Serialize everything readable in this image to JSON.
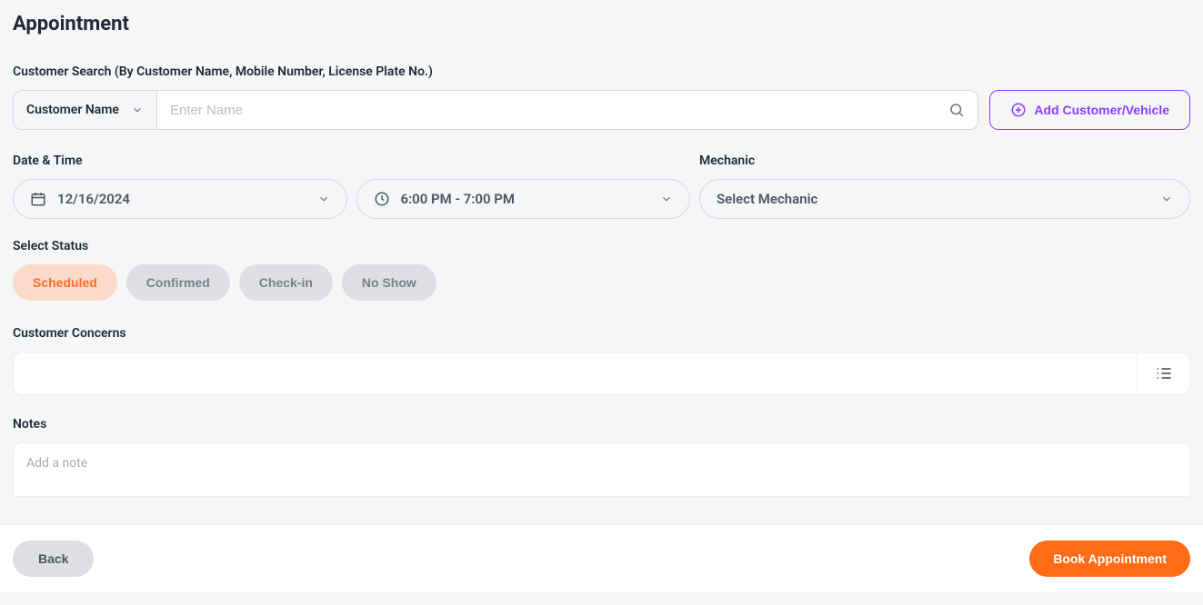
{
  "page_title": "Appointment",
  "customer_search": {
    "label": "Customer Search (By Customer Name, Mobile Number, License Plate No.)",
    "search_type": "Customer Name",
    "placeholder": "Enter Name",
    "value": ""
  },
  "add_customer_button": "Add Customer/Vehicle",
  "datetime": {
    "label": "Date & Time",
    "date": "12/16/2024",
    "time": "6:00 PM - 7:00 PM"
  },
  "mechanic": {
    "label": "Mechanic",
    "placeholder": "Select Mechanic",
    "value": ""
  },
  "status": {
    "label": "Select Status",
    "options": [
      "Scheduled",
      "Confirmed",
      "Check-in",
      "No Show"
    ],
    "selected": "Scheduled"
  },
  "concerns": {
    "label": "Customer Concerns"
  },
  "notes": {
    "label": "Notes",
    "placeholder": "Add a note",
    "value": ""
  },
  "footer": {
    "back": "Back",
    "book": "Book Appointment"
  }
}
